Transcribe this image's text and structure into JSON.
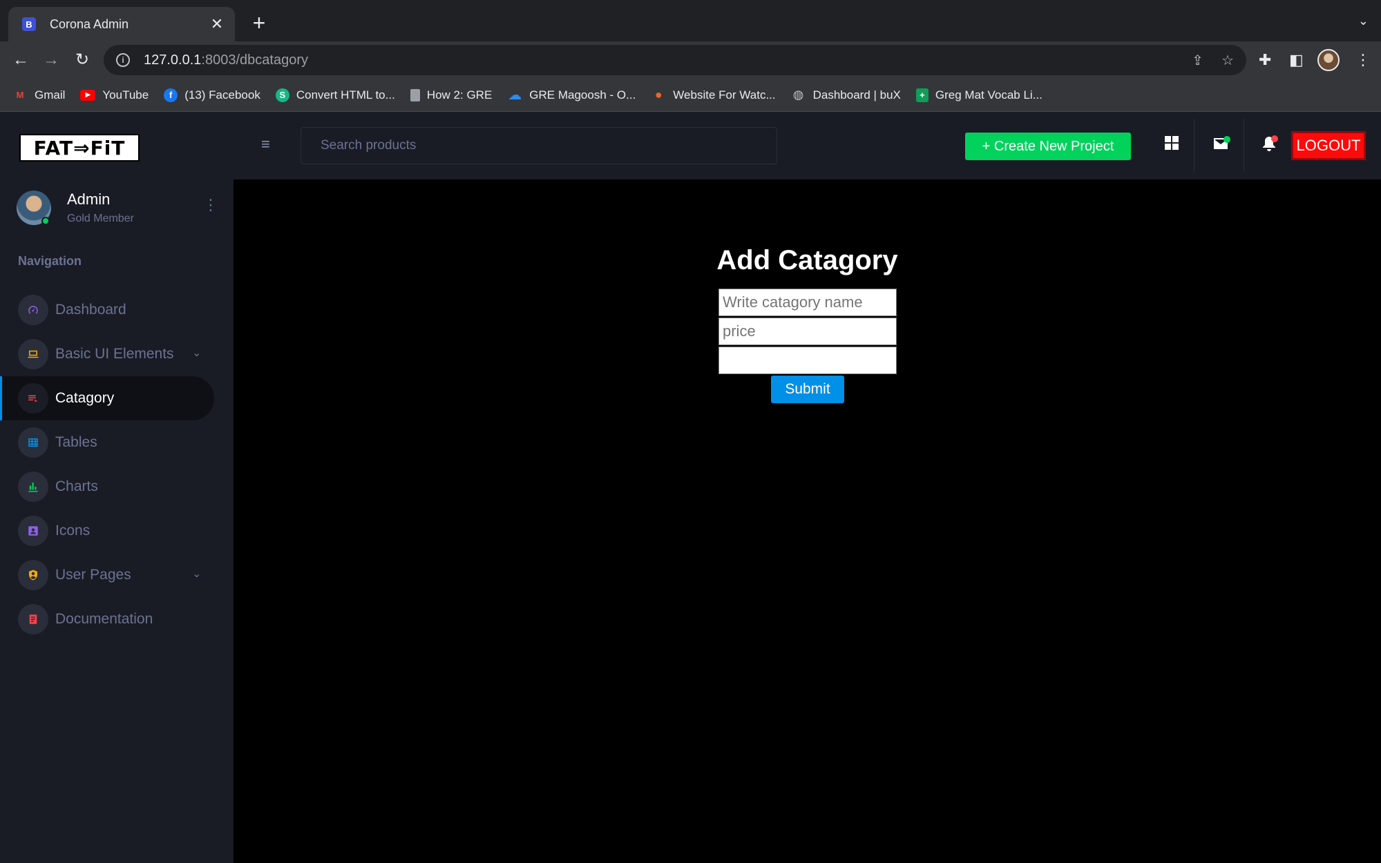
{
  "browser": {
    "tab_title": "Corona Admin",
    "tab_favicon_letter": "B",
    "url_host": "127.0.0.1",
    "url_path": ":8003/dbcatagory",
    "bookmarks": [
      {
        "label": "Gmail",
        "icon": "gmail-icon"
      },
      {
        "label": "YouTube",
        "icon": "youtube-icon"
      },
      {
        "label": "(13) Facebook",
        "icon": "facebook-icon"
      },
      {
        "label": "Convert HTML to...",
        "icon": "convert-icon"
      },
      {
        "label": "How 2: GRE",
        "icon": "document-icon"
      },
      {
        "label": "GRE Magoosh - O...",
        "icon": "cloud-icon"
      },
      {
        "label": "Website For Watc...",
        "icon": "figure-icon"
      },
      {
        "label": "Dashboard | buX",
        "icon": "globe-icon"
      },
      {
        "label": "Greg Mat Vocab Li...",
        "icon": "sheets-icon"
      }
    ]
  },
  "sidebar": {
    "brand": "FAT⇒FiT",
    "profile": {
      "name": "Admin",
      "role": "Gold Member"
    },
    "nav_heading": "Navigation",
    "items": [
      {
        "label": "Dashboard",
        "icon": "speedometer-icon",
        "icon_color": "#8f5fe8",
        "active": false,
        "caret": false
      },
      {
        "label": "Basic UI Elements",
        "icon": "laptop-icon",
        "icon_color": "#ffab00",
        "active": false,
        "caret": true
      },
      {
        "label": "Catagory",
        "icon": "playlist-icon",
        "icon_color": "#fc424a",
        "active": true,
        "caret": false
      },
      {
        "label": "Tables",
        "icon": "table-icon",
        "icon_color": "#0090e7",
        "active": false,
        "caret": false
      },
      {
        "label": "Charts",
        "icon": "chart-bar-icon",
        "icon_color": "#00d25b",
        "active": false,
        "caret": false
      },
      {
        "label": "Icons",
        "icon": "contacts-icon",
        "icon_color": "#8f5fe8",
        "active": false,
        "caret": false
      },
      {
        "label": "User Pages",
        "icon": "security-icon",
        "icon_color": "#ffab00",
        "active": false,
        "caret": true
      },
      {
        "label": "Documentation",
        "icon": "file-document-icon",
        "icon_color": "#fc424a",
        "active": false,
        "caret": false
      }
    ]
  },
  "topbar": {
    "search_placeholder": "Search products",
    "create_label": "+ Create New Project",
    "logout_label": "LOGOUT"
  },
  "form": {
    "title": "Add Catagory",
    "name_placeholder": "Write catagory name",
    "price_placeholder": "price",
    "extra_value": "",
    "submit_label": "Submit"
  },
  "colors": {
    "accent_green": "#00d25b",
    "accent_blue": "#0090e7",
    "logout_red": "#ff0a0a",
    "sidebar_bg": "#191c24"
  }
}
